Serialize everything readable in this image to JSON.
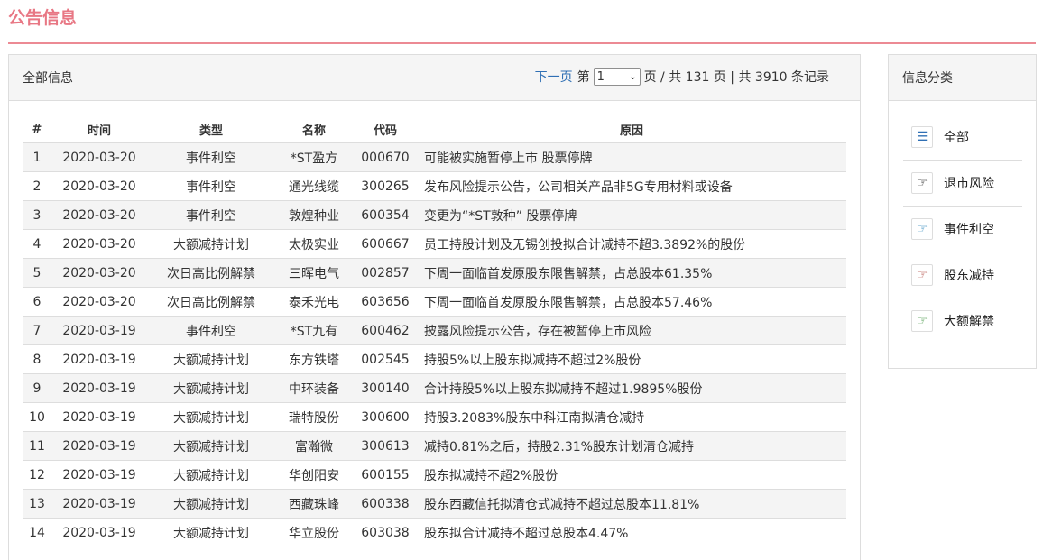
{
  "page": {
    "title": "公告信息"
  },
  "main": {
    "heading": "全部信息",
    "pager": {
      "next_label": "下一页",
      "prefix": "第",
      "current_page": "1",
      "suffix": "页 / 共 131 页 | 共 3910 条记录"
    },
    "columns": [
      "#",
      "时间",
      "类型",
      "名称",
      "代码",
      "原因"
    ],
    "rows": [
      {
        "num": "1",
        "date": "2020-03-20",
        "type": "事件利空",
        "name": "*ST盈方",
        "code": "000670",
        "reason": "可能被实施暂停上市 股票停牌"
      },
      {
        "num": "2",
        "date": "2020-03-20",
        "type": "事件利空",
        "name": "通光线缆",
        "code": "300265",
        "reason": "发布风险提示公告，公司相关产品非5G专用材料或设备"
      },
      {
        "num": "3",
        "date": "2020-03-20",
        "type": "事件利空",
        "name": "敦煌种业",
        "code": "600354",
        "reason": "变更为“*ST敦种” 股票停牌"
      },
      {
        "num": "4",
        "date": "2020-03-20",
        "type": "大额减持计划",
        "name": "太极实业",
        "code": "600667",
        "reason": "员工持股计划及无锡创投拟合计减持不超3.3892%的股份"
      },
      {
        "num": "5",
        "date": "2020-03-20",
        "type": "次日高比例解禁",
        "name": "三晖电气",
        "code": "002857",
        "reason": "下周一面临首发原股东限售解禁，占总股本61.35%"
      },
      {
        "num": "6",
        "date": "2020-03-20",
        "type": "次日高比例解禁",
        "name": "泰禾光电",
        "code": "603656",
        "reason": "下周一面临首发原股东限售解禁，占总股本57.46%"
      },
      {
        "num": "7",
        "date": "2020-03-19",
        "type": "事件利空",
        "name": "*ST九有",
        "code": "600462",
        "reason": "披露风险提示公告，存在被暂停上市风险"
      },
      {
        "num": "8",
        "date": "2020-03-19",
        "type": "大额减持计划",
        "name": "东方铁塔",
        "code": "002545",
        "reason": "持股5%以上股东拟减持不超过2%股份"
      },
      {
        "num": "9",
        "date": "2020-03-19",
        "type": "大额减持计划",
        "name": "中环装备",
        "code": "300140",
        "reason": "合计持股5%以上股东拟减持不超过1.9895%股份"
      },
      {
        "num": "10",
        "date": "2020-03-19",
        "type": "大额减持计划",
        "name": "瑞特股份",
        "code": "300600",
        "reason": "持股3.2083%股东中科江南拟清仓减持"
      },
      {
        "num": "11",
        "date": "2020-03-19",
        "type": "大额减持计划",
        "name": "富瀚微",
        "code": "300613",
        "reason": "减持0.81%之后，持股2.31%股东计划清仓减持"
      },
      {
        "num": "12",
        "date": "2020-03-19",
        "type": "大额减持计划",
        "name": "华创阳安",
        "code": "600155",
        "reason": "股东拟减持不超2%股份"
      },
      {
        "num": "13",
        "date": "2020-03-19",
        "type": "大额减持计划",
        "name": "西藏珠峰",
        "code": "600338",
        "reason": "股东西藏信托拟清仓式减持不超过总股本11.81%"
      },
      {
        "num": "14",
        "date": "2020-03-19",
        "type": "大额减持计划",
        "name": "华立股份",
        "code": "603038",
        "reason": "股东拟合计减持不超过总股本4.47%"
      }
    ]
  },
  "sidebar": {
    "heading": "信息分类",
    "items": [
      {
        "label": "全部",
        "icon": "list-icon",
        "color": "#2f6fb4"
      },
      {
        "label": "退市风险",
        "icon": "hand-point-right-icon",
        "color": "#222222"
      },
      {
        "label": "事件利空",
        "icon": "hand-point-right-icon",
        "color": "#3a8ec0"
      },
      {
        "label": "股东减持",
        "icon": "hand-point-right-icon",
        "color": "#b3504a"
      },
      {
        "label": "大额解禁",
        "icon": "hand-point-right-icon",
        "color": "#4a9a4a"
      }
    ]
  }
}
